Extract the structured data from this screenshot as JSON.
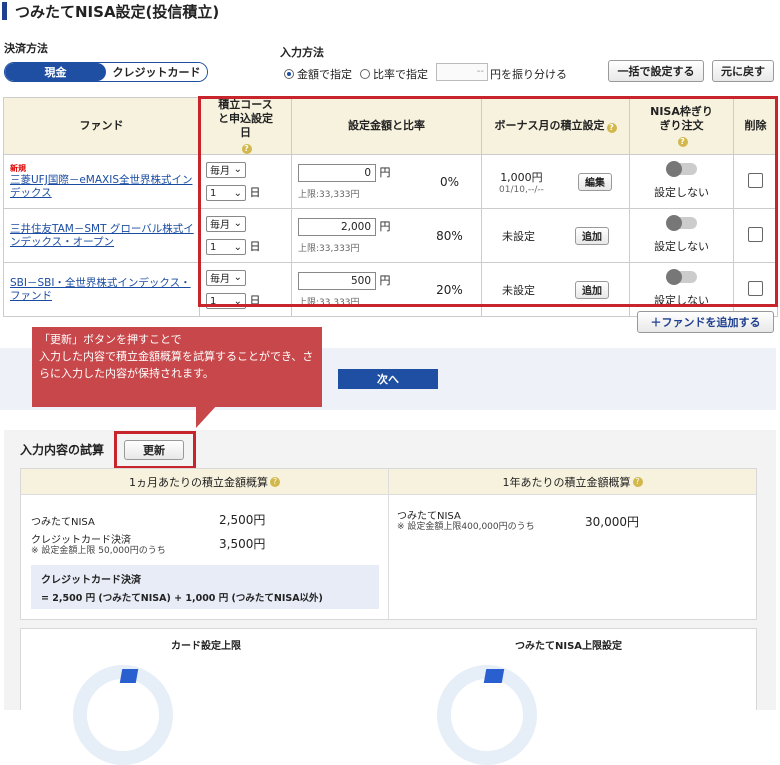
{
  "page": {
    "title": "つみたてNISA設定(投信積立)"
  },
  "payment": {
    "label": "決済方法",
    "options": [
      "現金",
      "クレジットカード"
    ],
    "selected": "現金"
  },
  "input_method": {
    "label": "入力方法",
    "option_amount": "金額で指定",
    "option_ratio": "比率で指定",
    "ratio_value": "",
    "ratio_suffix": "円を振り分ける",
    "bulk_button": "一括で設定する",
    "reset_button": "元に戻す"
  },
  "table": {
    "headers": {
      "fund": "ファンド",
      "course": "積立コースと申込設定日",
      "amount": "設定金額と比率",
      "bonus": "ボーナス月の積立設定",
      "nisa": "NISA枠ぎりぎり注文",
      "delete": "削除"
    },
    "rows": [
      {
        "badge": "新規",
        "fund": "三菱UFJ国際－eMAXIS全世界株式インデックス",
        "course": "毎月",
        "day": "1",
        "day_unit": "日",
        "amount": "0",
        "yen": "円",
        "limit": "上限:33,333円",
        "ratio": "0%",
        "bonus": "1,000円",
        "bonus_sub": "01/10,--/--",
        "bonus_btn": "編集",
        "nisa": "設定しない"
      },
      {
        "badge": "",
        "fund": "三井住友TAM－SMT グローバル株式インデックス・オープン",
        "course": "毎月",
        "day": "1",
        "day_unit": "日",
        "amount": "2,000",
        "yen": "円",
        "limit": "上限:33,333円",
        "ratio": "80%",
        "bonus": "未設定",
        "bonus_sub": "",
        "bonus_btn": "追加",
        "nisa": "設定しない"
      },
      {
        "badge": "",
        "fund": "SBI－SBI・全世界株式インデックス・ファンド",
        "course": "毎月",
        "day": "1",
        "day_unit": "日",
        "amount": "500",
        "yen": "円",
        "limit": "上限:33,333円",
        "ratio": "20%",
        "bonus": "未設定",
        "bonus_sub": "",
        "bonus_btn": "追加",
        "nisa": "設定しない"
      }
    ]
  },
  "add_fund_button": "＋ファンドを追加する",
  "callout": {
    "line1": "「更新」ボタンを押すことで",
    "line2": "入力した内容で積立金額概算を試算することができ、さらに入力した内容が保持されます。"
  },
  "next_button": "次へ",
  "trial": {
    "label": "入力内容の試算",
    "update_button": "更新",
    "monthly": {
      "head": "1ヵ月あたりの積立金額概算",
      "nisa_label": "つみたてNISA",
      "nisa_value": "2,500円",
      "card_label": "クレジットカード決済",
      "card_note": "※ 設定金額上限 50,000円のうち",
      "card_value": "3,500円",
      "box_title": "クレジットカード決済",
      "box_formula": "= 2,500 円 (つみたてNISA) + 1,000 円 (つみたてNISA以外)"
    },
    "yearly": {
      "head": "1年あたりの積立金額概算",
      "nisa_label": "つみたてNISA",
      "nisa_note": "※ 設定金額上限400,000円のうち",
      "nisa_value": "30,000円"
    },
    "card_limit_title": "カード設定上限",
    "nisa_limit_title": "つみたてNISA上限設定"
  },
  "colors": {
    "accent": "#1f4fa3",
    "highlight": "#c8242b",
    "header_bg": "#f7f2de"
  }
}
